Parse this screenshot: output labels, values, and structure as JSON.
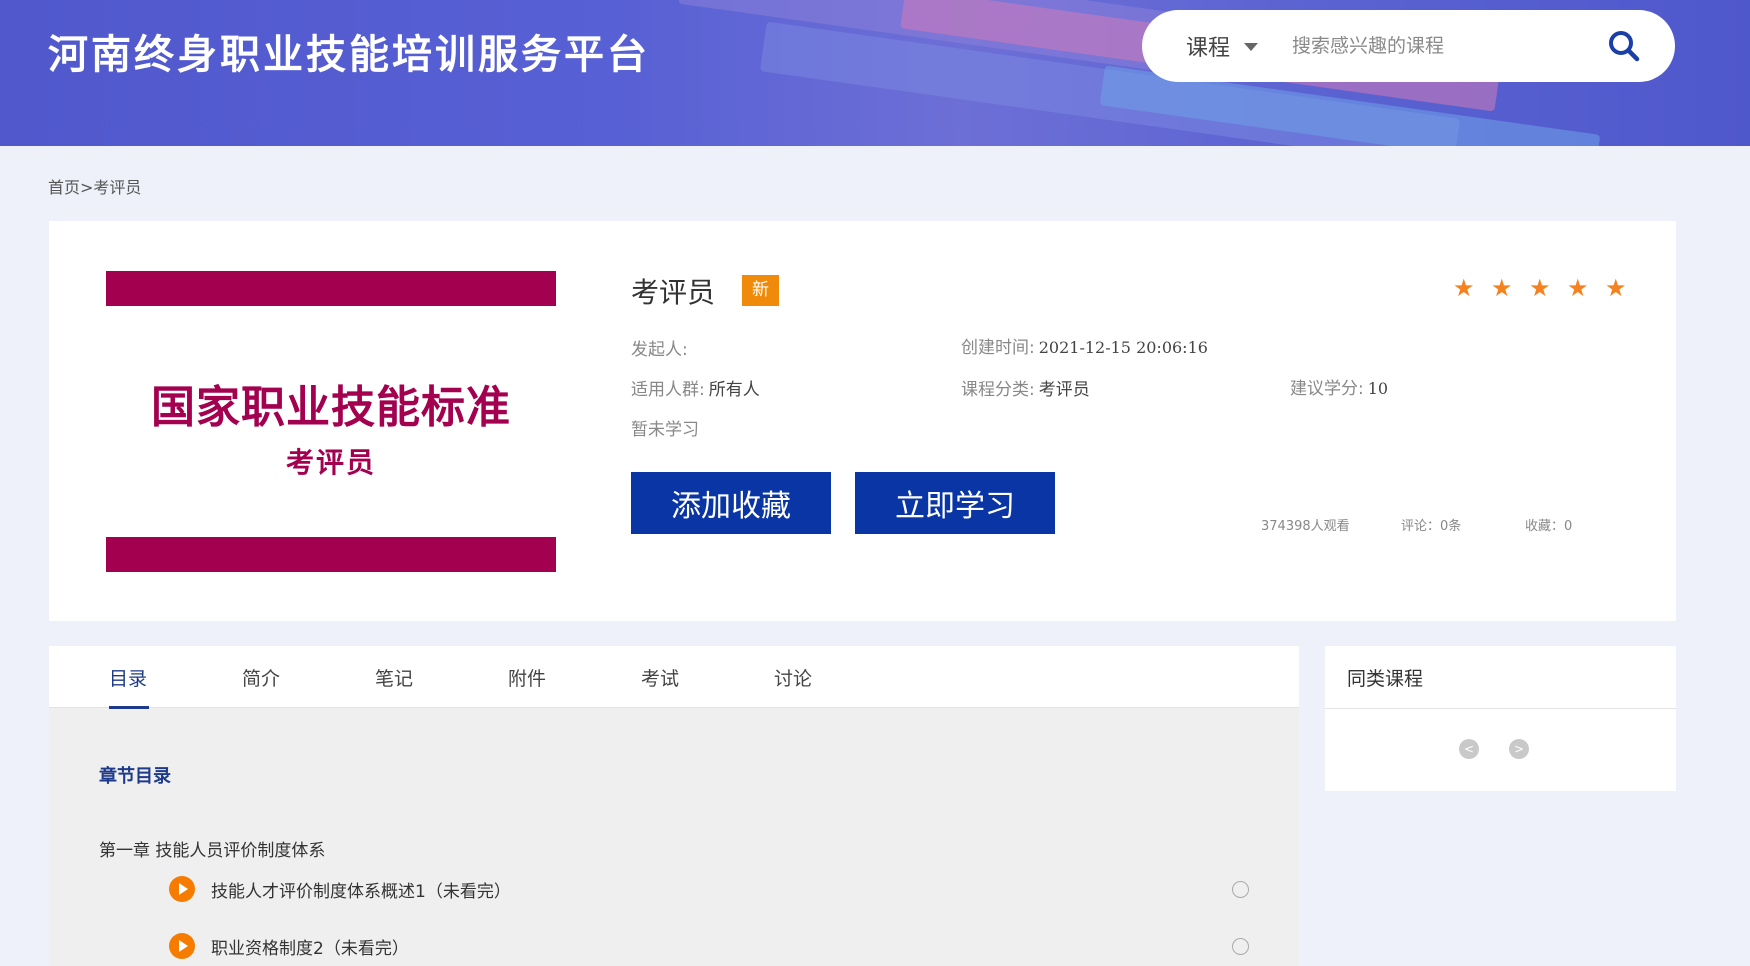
{
  "header": {
    "site_title": "河南终身职业技能培训服务平台",
    "search": {
      "category": "课程",
      "placeholder": "搜索感兴趣的课程"
    }
  },
  "breadcrumb": {
    "home": "首页",
    "separator": ">",
    "current": "考评员"
  },
  "course": {
    "cover_title": "国家职业技能标准",
    "cover_subtitle": "考评员",
    "name": "考评员",
    "badge": "新",
    "rating_stars": 5,
    "initiator_label": "发起人:",
    "created_label": "创建时间:",
    "created_value": "2021-12-15 20:06:16",
    "audience_label": "适用人群:",
    "audience_value": "所有人",
    "category_label": "课程分类:",
    "category_value": "考评员",
    "credits_label": "建议学分:",
    "credits_value": "10",
    "study_status": "暂未学习",
    "favorite_button": "添加收藏",
    "study_button": "立即学习",
    "views": "374398人观看",
    "comments": "评论：0条",
    "favorites": "收藏：0"
  },
  "tabs": [
    "目录",
    "简介",
    "笔记",
    "附件",
    "考试",
    "讨论"
  ],
  "catalog": {
    "heading": "章节目录",
    "chapter": "第一章 技能人员评价制度体系",
    "lessons": [
      "技能人才评价制度体系概述1（未看完）",
      "职业资格制度2（未看完）"
    ]
  },
  "side": {
    "title": "同类课程",
    "prev": "<",
    "next": ">"
  },
  "colors": {
    "header_bg": "#5760d4",
    "button_blue": "#0a35a5",
    "badge_orange": "#f08a0a",
    "star_orange": "#f58220",
    "cover_magenta": "#a30050",
    "accent_navy": "#1e3a8a"
  }
}
